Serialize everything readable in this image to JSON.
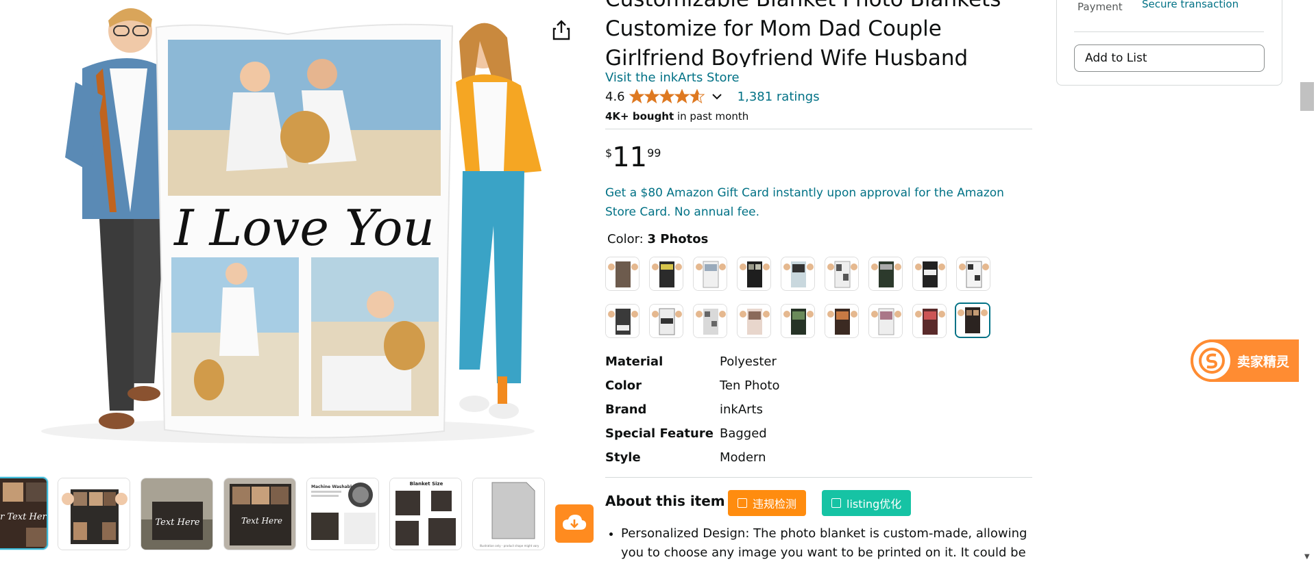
{
  "product": {
    "title": "Customizable Blanket Photo Blankets Customize for Mom Dad Couple Girlfriend Boyfriend Wife Husband",
    "store_link": "Visit the inkArts Store",
    "rating": "4.6",
    "ratings_count": "1,381 ratings",
    "bought_bold": "4K+ bought",
    "bought_rest": " in past month",
    "price": {
      "symbol": "$",
      "whole": "11",
      "fraction": "99"
    },
    "gift_card": "Get a $80 Amazon Gift Card instantly upon approval for the Amazon Store Card. No annual fee.",
    "color_label": "Color:",
    "color_value": "3 Photos",
    "specs": [
      {
        "k": "Material",
        "v": "Polyester"
      },
      {
        "k": "Color",
        "v": "Ten Photo"
      },
      {
        "k": "Brand",
        "v": "inkArts"
      },
      {
        "k": "Special Feature",
        "v": "Bagged"
      },
      {
        "k": "Style",
        "v": "Modern"
      }
    ],
    "about_title": "About this item",
    "tag_buttons": [
      "违规检测",
      "listing优化"
    ],
    "bullet_1": "Personalized Design: The photo blanket is custom-made, allowing you to choose any image you want to be printed on it. It could be a"
  },
  "main_image": {
    "blanket_text": "I Love You"
  },
  "buybox": {
    "payment_label": "Payment",
    "secure_link": "Secure transaction",
    "add_to_list": "Add to List"
  },
  "thumbnails": {
    "thumb_1_text": "Your Text Here",
    "thumb_3_text": "Text Here",
    "thumb_4_text": "Text Here",
    "thumb_5_title": "Machine Washable",
    "thumb_6_title": "Blanket Size",
    "thumb_7_caption": "Illustration only - product shape might vary"
  },
  "seller_badge": {
    "label": "卖家精灵"
  },
  "colors": {
    "link": "#007185",
    "accent_orange": "#ff8c32",
    "teal": "#16c3a4",
    "selected_border": "#007185"
  }
}
